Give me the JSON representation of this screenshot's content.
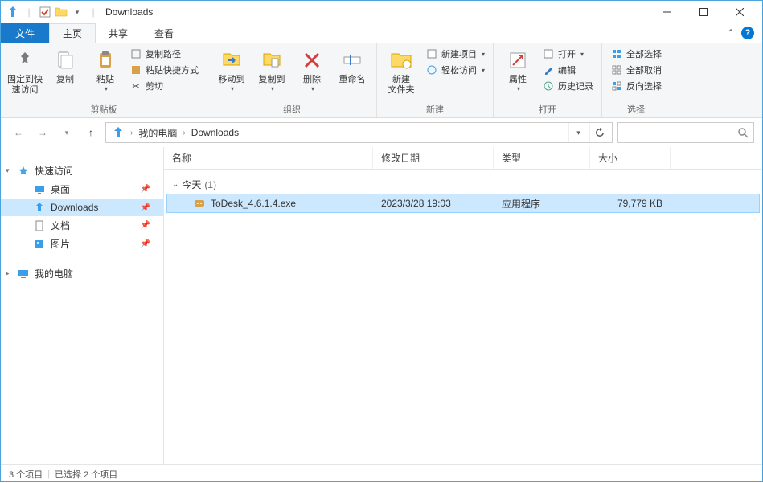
{
  "window": {
    "title": "Downloads"
  },
  "ribbon": {
    "file_tab": "文件",
    "tabs": [
      "主页",
      "共享",
      "查看"
    ],
    "active_tab_index": 0,
    "groups": {
      "clipboard": {
        "label": "剪贴板",
        "pin": "固定到快\n速访问",
        "copy": "复制",
        "paste": "粘贴",
        "copy_path": "复制路径",
        "paste_shortcut": "粘贴快捷方式",
        "cut": "剪切"
      },
      "organize": {
        "label": "组织",
        "move_to": "移动到",
        "copy_to": "复制到",
        "delete": "删除",
        "rename": "重命名"
      },
      "new": {
        "label": "新建",
        "new_folder": "新建\n文件夹",
        "new_item": "新建项目",
        "easy_access": "轻松访问"
      },
      "open": {
        "label": "打开",
        "properties": "属性",
        "open": "打开",
        "edit": "编辑",
        "history": "历史记录"
      },
      "select": {
        "label": "选择",
        "select_all": "全部选择",
        "select_none": "全部取消",
        "invert": "反向选择"
      }
    }
  },
  "breadcrumb": {
    "root": "我的电脑",
    "items": [
      "Downloads"
    ]
  },
  "sidebar": {
    "quick_access": "快速访问",
    "desktop": "桌面",
    "downloads": "Downloads",
    "documents": "文档",
    "pictures": "图片",
    "this_pc": "我的电脑"
  },
  "columns": {
    "name": "名称",
    "date": "修改日期",
    "type": "类型",
    "size": "大小"
  },
  "group": {
    "label": "今天",
    "count": "(1)"
  },
  "files": [
    {
      "name": "ToDesk_4.6.1.4.exe",
      "date": "2023/3/28 19:03",
      "type": "应用程序",
      "size": "79,779 KB",
      "selected": true
    }
  ],
  "status": {
    "items": "3 个项目",
    "selected": "已选择 2 个项目"
  }
}
